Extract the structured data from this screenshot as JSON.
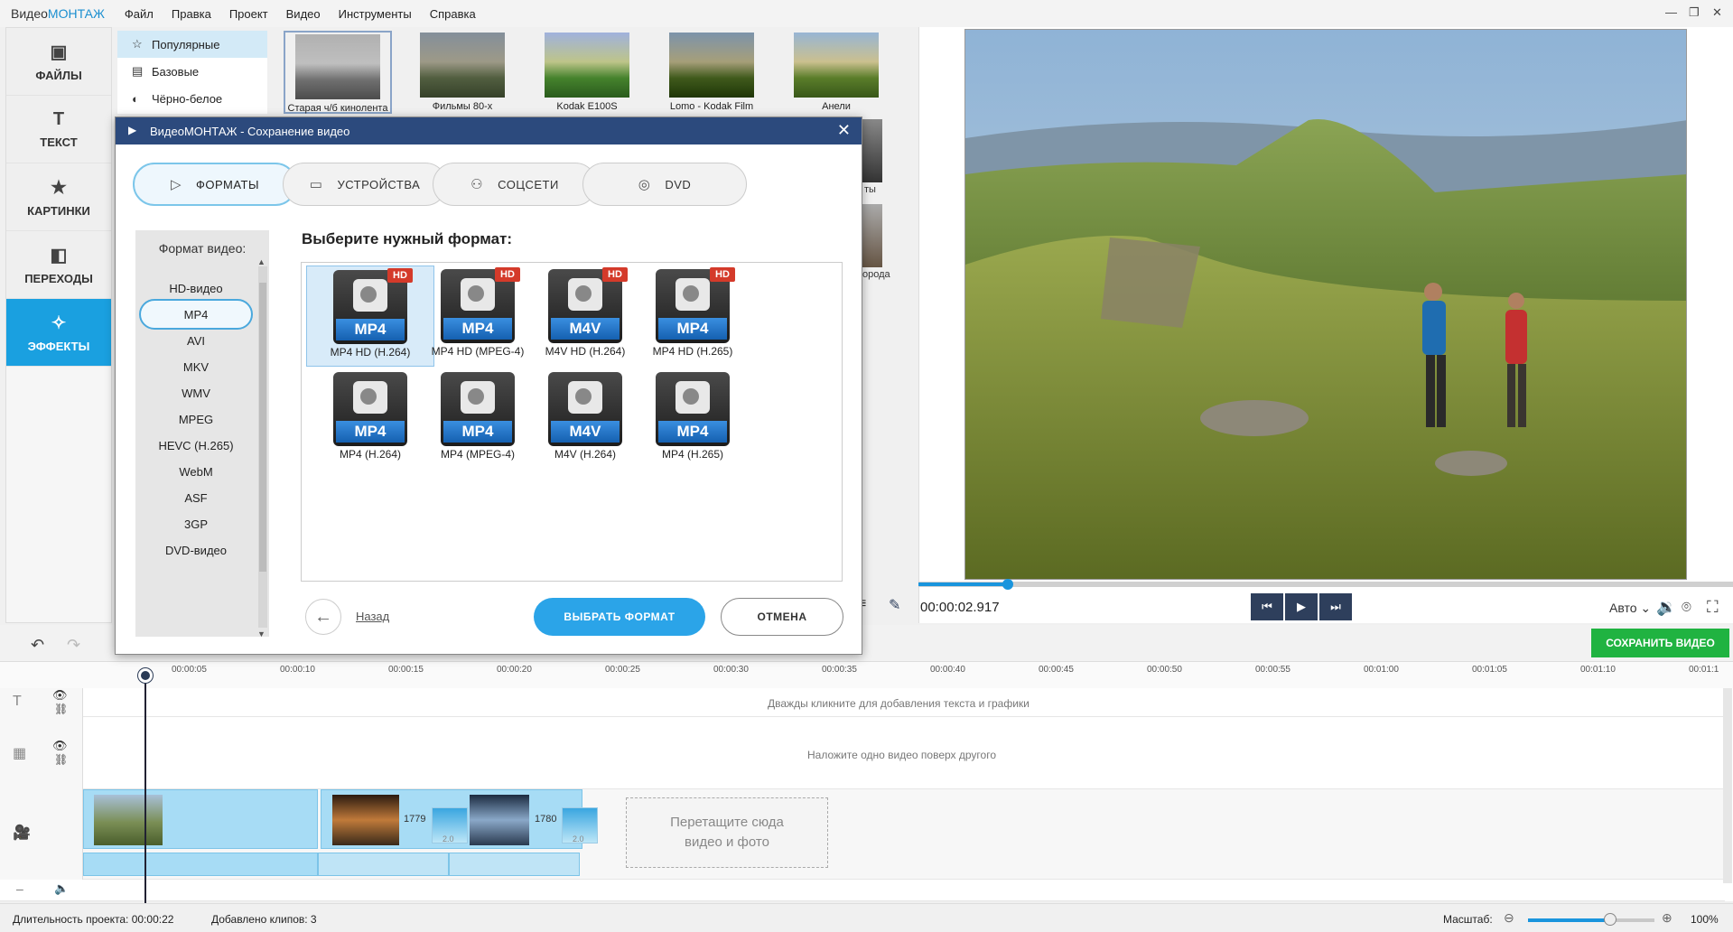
{
  "app": {
    "logo_a": "Видео",
    "logo_b": "МОНТАЖ"
  },
  "menu": [
    "Файл",
    "Правка",
    "Проект",
    "Видео",
    "Инструменты",
    "Справка"
  ],
  "nav": [
    {
      "label": "ФАЙЛЫ",
      "icon": "image-icon"
    },
    {
      "label": "ТЕКСТ",
      "icon": "text-icon"
    },
    {
      "label": "КАРТИНКИ",
      "icon": "star-icon"
    },
    {
      "label": "ПЕРЕХОДЫ",
      "icon": "transitions-icon"
    },
    {
      "label": "ЭФФЕКТЫ",
      "icon": "magic-wand-icon"
    }
  ],
  "effect_categories": [
    "Популярные",
    "Базовые",
    "Чёрно-белое"
  ],
  "effect_thumbs": [
    "Старая ч/б кинолента",
    "Фильмы 80-х",
    "Kodak E100S",
    "Lomo - Kodak Film",
    "Анели"
  ],
  "effect_partial": [
    "ты",
    "орода"
  ],
  "preview": {
    "time": "00:00:02.917",
    "quality": "Авто",
    "progress": 0.11
  },
  "save_video": "СОХРАНИТЬ ВИДЕО",
  "ruler": [
    "00:00:05",
    "00:00:10",
    "00:00:15",
    "00:00:20",
    "00:00:25",
    "00:00:30",
    "00:00:35",
    "00:00:40",
    "00:00:45",
    "00:00:50",
    "00:00:55",
    "00:01:00",
    "00:01:05",
    "00:01:10",
    "00:01:1"
  ],
  "timeline": {
    "text_hint": "Дважды кликните для добавления текста и графики",
    "overlay_hint": "Наложите одно видео поверх другого",
    "clip_label_1": "1779",
    "clip_label_2": "1780",
    "trans_1": "2.0",
    "trans_2": "2.0",
    "drop_line1": "Перетащите сюда",
    "drop_line2": "видео и фото"
  },
  "status": {
    "duration": "Длительность проекта: 00:00:22",
    "clips": "Добавлено клипов: 3",
    "zoom_label": "Масштаб:",
    "zoom_value": "100%",
    "zoom_level": 0.65
  },
  "dialog": {
    "title": "ВидеоМОНТАЖ - Сохранение видео",
    "tabs": [
      "ФОРМАТЫ",
      "УСТРОЙСТВА",
      "СОЦСЕТИ",
      "DVD"
    ],
    "format_label": "Формат видео:",
    "formats": [
      "HD-видео",
      "MP4",
      "AVI",
      "MKV",
      "WMV",
      "MPEG",
      "HEVC (H.265)",
      "WebM",
      "ASF",
      "3GP",
      "DVD-видео"
    ],
    "choose_title": "Выберите нужный формат:",
    "items": [
      {
        "badge": "MP4",
        "hd": "HD",
        "name": "MP4 HD (H.264)"
      },
      {
        "badge": "MP4",
        "hd": "HD",
        "name": "MP4 HD (MPEG-4)"
      },
      {
        "badge": "M4V",
        "hd": "HD",
        "name": "M4V HD (H.264)"
      },
      {
        "badge": "MP4",
        "hd": "HD",
        "name": "MP4 HD (H.265)"
      },
      {
        "badge": "MP4",
        "hd": "",
        "name": "MP4 (H.264)"
      },
      {
        "badge": "MP4",
        "hd": "",
        "name": "MP4 (MPEG-4)"
      },
      {
        "badge": "M4V",
        "hd": "",
        "name": "M4V (H.264)"
      },
      {
        "badge": "MP4",
        "hd": "",
        "name": "MP4 (H.265)"
      }
    ],
    "back": "Назад",
    "choose_btn": "ВЫБРАТЬ ФОРМАТ",
    "cancel_btn": "ОТМЕНА"
  }
}
